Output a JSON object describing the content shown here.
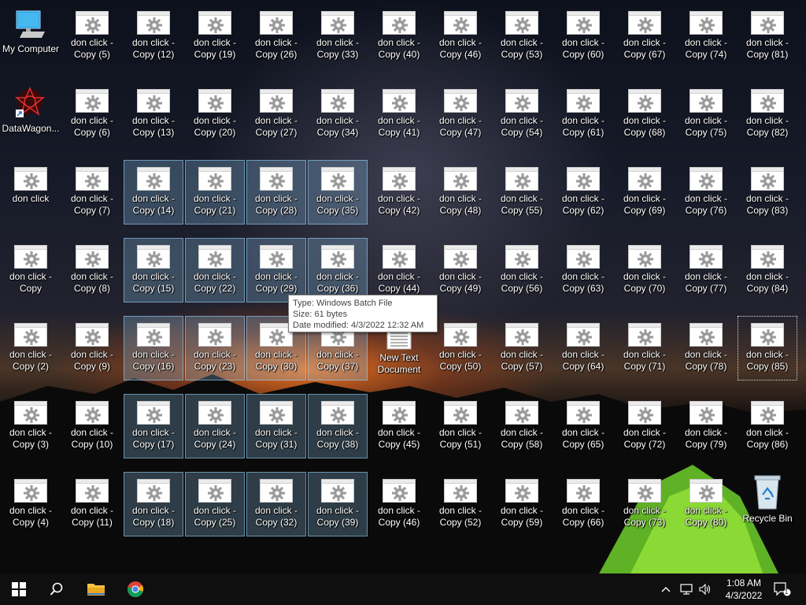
{
  "desktop": {
    "special_icons": {
      "my_computer": "My Computer",
      "datawagon": "DataWagon...",
      "new_text": [
        "New Text",
        "Document"
      ],
      "recycle_bin": "Recycle Bin",
      "base_file": "don click"
    },
    "file_prefix": "don click -",
    "file_copy_base": "Copy",
    "selected_copies": [
      14,
      15,
      16,
      17,
      18,
      21,
      22,
      23,
      24,
      25,
      28,
      29,
      30,
      31,
      32,
      35,
      36,
      37,
      38,
      39
    ],
    "focused_copy": 85
  },
  "tooltip": {
    "type": "Type: Windows Batch File",
    "size": "Size: 61 bytes",
    "modified": "Date modified: 4/3/2022 12:32 AM"
  },
  "taskbar": {
    "start": "start-icon",
    "search": "search-icon",
    "explorer": "file-explorer-icon",
    "chrome": "chrome-icon",
    "time": "1:08 AM",
    "date": "4/3/2022",
    "notification_count": "1"
  },
  "colors": {
    "selection": "#99d9ff",
    "taskbar": "#0f0f10",
    "folder": "#f5c342"
  }
}
